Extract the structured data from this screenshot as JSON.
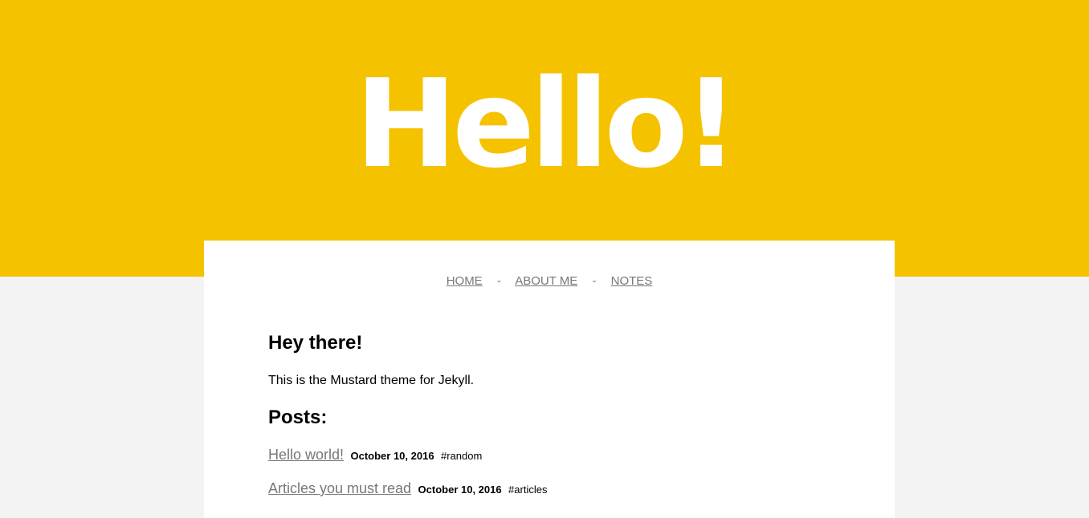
{
  "hero": {
    "title": "Hello!"
  },
  "nav": {
    "items": [
      {
        "label": "HOME"
      },
      {
        "label": "ABOUT ME"
      },
      {
        "label": "NOTES"
      }
    ],
    "separator": "-"
  },
  "content": {
    "heading": "Hey there!",
    "intro": "This is the Mustard theme for Jekyll.",
    "posts_heading": "Posts:",
    "posts": [
      {
        "title": "Hello world!",
        "date": "October 10, 2016",
        "tag": "#random"
      },
      {
        "title": "Articles you must read",
        "date": "October 10, 2016",
        "tag": "#articles"
      }
    ]
  },
  "colors": {
    "hero_background": "#f5c200",
    "page_background": "#f3f3f3",
    "card_background": "#ffffff",
    "link": "#777777"
  }
}
